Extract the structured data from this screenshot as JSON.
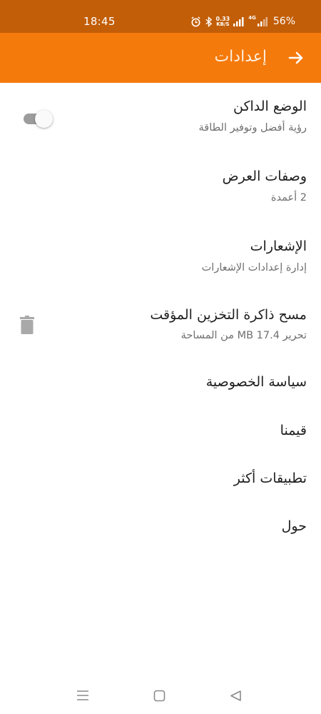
{
  "status_bar": {
    "time": "18:45",
    "net_speed_value": "0.33",
    "net_speed_unit": "KB/S",
    "network_type": "4G",
    "battery": "56%",
    "icons": [
      "alarm-icon",
      "bluetooth-icon",
      "signal-icon",
      "signal-4g-icon"
    ]
  },
  "app_bar": {
    "title": "إعدادات",
    "back_icon": "arrow-right-icon",
    "color": "#f57a0c"
  },
  "settings": {
    "dark_mode": {
      "title": "الوضع الداكن",
      "subtitle": "رؤية أفضل وتوفير الطاقة",
      "enabled": false
    },
    "display_columns": {
      "title": "وصفات العرض",
      "subtitle": "2 أعمدة"
    },
    "notifications": {
      "title": "الإشعارات",
      "subtitle": "إدارة إعدادات الإشعارات"
    },
    "clear_cache": {
      "title": "مسح ذاكرة التخزين المؤقت",
      "subtitle": "تحرير 17.4 MB من المساحة",
      "icon": "trash-icon"
    },
    "privacy_policy": {
      "title": "سياسة الخصوصية"
    },
    "rate_us": {
      "title": "قيمنا"
    },
    "more_apps": {
      "title": "تطبيقات أكثر"
    },
    "about": {
      "title": "حول"
    }
  },
  "nav_bar": {
    "icons": [
      "menu-icon",
      "home-square-icon",
      "back-triangle-icon"
    ]
  }
}
